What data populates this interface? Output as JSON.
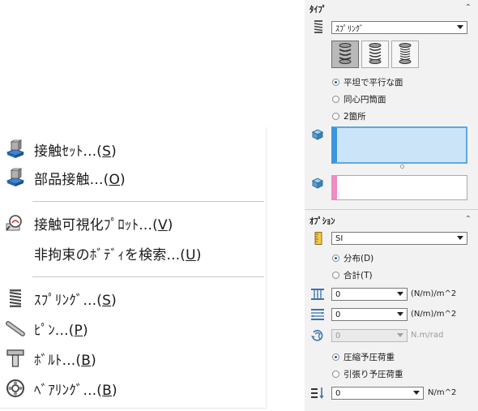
{
  "menu": {
    "items": [
      {
        "label": "接触ｾｯﾄ...(",
        "key": "S",
        "end": ")",
        "icon": "contact-set-icon"
      },
      {
        "label": "部品接触...(",
        "key": "O",
        "end": ")",
        "icon": "component-contact-icon"
      },
      {
        "label": "接触可視化ﾌﾟﾛｯﾄ...(",
        "key": "V",
        "end": ")",
        "icon": "contact-visualization-icon"
      },
      {
        "label": "非拘束のﾎﾞﾃﾞｨを検索...(",
        "key": "U",
        "end": ")",
        "icon": ""
      },
      {
        "label": "ｽﾌﾟﾘﾝｸﾞ...(",
        "key": "S",
        "end": ")",
        "icon": "spring-icon"
      },
      {
        "label": "ﾋﾟﾝ...(",
        "key": "P",
        "end": ")",
        "icon": "pin-icon"
      },
      {
        "label": "ﾎﾞﾙﾄ...(",
        "key": "B",
        "end": ")",
        "icon": "bolt-icon"
      },
      {
        "label": "ﾍﾞｱﾘﾝｸﾞ...(",
        "key": "B",
        "end": ")",
        "icon": "bearing-icon"
      }
    ]
  },
  "panel": {
    "type_section": {
      "title": "ﾀｲﾌﾟ",
      "type_select": "ｽﾌﾟﾘﾝｸﾞ",
      "spring_type_buttons": [
        "compression-spring-icon",
        "extension-spring-icon",
        "both-spring-icon"
      ],
      "selected_button": 0,
      "radios": [
        "平坦で平行な面",
        "同心円筒面",
        "2箇所"
      ],
      "selected_radio": 0
    },
    "options_section": {
      "title": "ｵﾌﾟｼｮﾝ",
      "unit_select": "SI",
      "radios_a": [
        "分布(D)",
        "合計(T)"
      ],
      "selected_radio_a": 0,
      "normal_stiffness": {
        "value": "0",
        "unit": "(N/m)/m^2"
      },
      "tangential_stiffness": {
        "value": "0",
        "unit": "(N/m)/m^2"
      },
      "rotational_stiffness": {
        "value": "0",
        "unit": "N.m/rad"
      },
      "radios_b": [
        "圧縮予圧荷重",
        "引張り予圧荷重"
      ],
      "selected_radio_b": 0,
      "preload": {
        "value": "0",
        "unit": "N/m^2"
      }
    },
    "colors": {
      "selection_blue": "#cce4f7",
      "selection_blue_border": "#5aa9e6",
      "selection_pink": "#f08cc0"
    }
  }
}
